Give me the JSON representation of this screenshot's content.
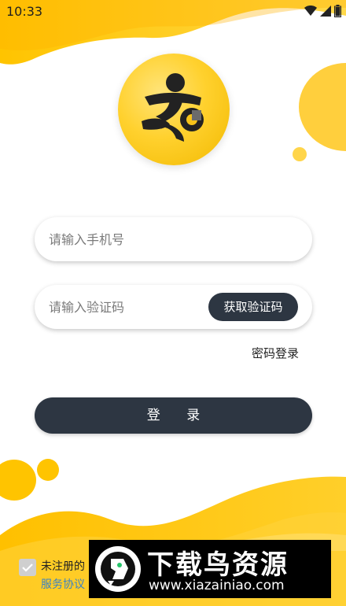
{
  "status_bar": {
    "time": "10:33"
  },
  "form": {
    "phone_placeholder": "请输入手机号",
    "code_placeholder": "请输入验证码",
    "get_code_label": "获取验证码",
    "password_login_label": "密码登录",
    "login_label": "登 录"
  },
  "agreement": {
    "text": "未注册的",
    "link": "服务协议"
  },
  "watermark": {
    "title": "下载鸟资源",
    "url": "www.xiazainiao.com"
  },
  "colors": {
    "accent_yellow": "#FFC107",
    "button_dark": "#2D3642",
    "link_blue": "#3A82C4"
  },
  "icons": {
    "logo": "person-wrench-logo-icon",
    "wifi": "wifi-icon",
    "signal": "signal-icon",
    "battery": "battery-icon",
    "check": "check-icon",
    "watermark_logo": "bird-logo-icon"
  }
}
